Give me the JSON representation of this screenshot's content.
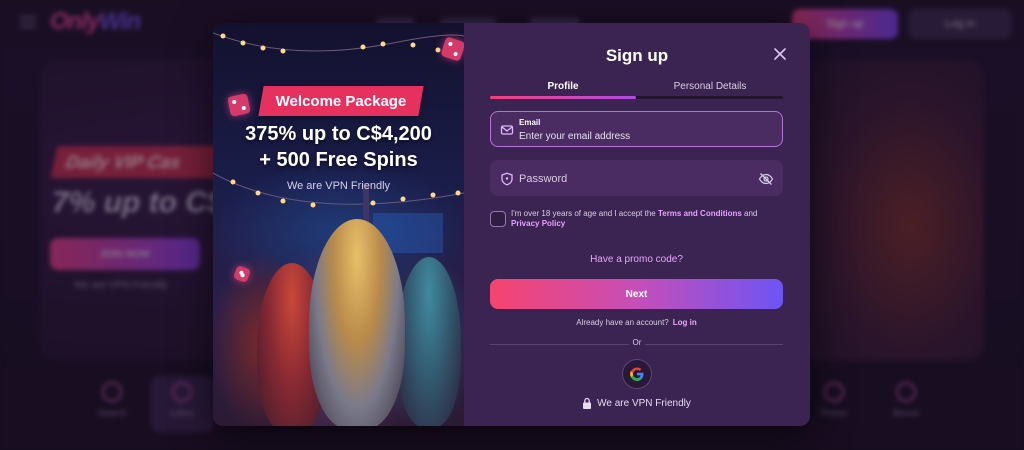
{
  "background": {
    "logo_part1": "Only",
    "logo_part2": "Win",
    "header_signup": "Sign up",
    "header_login": "Log in",
    "hero_ribbon": "Daily VIP Cas",
    "hero_big": "7% up to C$",
    "hero_join": "JOIN NOW",
    "hero_vpn": "We are VPN Friendly",
    "bottom_nav": [
      "Search",
      "Lobby",
      "Promo",
      "Bonus"
    ]
  },
  "promo": {
    "ribbon": "Welcome Package",
    "bonus_line1": "375% up to C$4,200",
    "bonus_line2": "+ 500 Free Spins",
    "vpn_text": "We are VPN Friendly"
  },
  "form": {
    "title": "Sign up",
    "tabs": [
      {
        "label": "Profile",
        "active": true
      },
      {
        "label": "Personal Details",
        "active": false
      }
    ],
    "email_label": "Email",
    "email_placeholder": "Enter your email address",
    "password_placeholder": "Password",
    "terms_prefix": "I'm over 18 years of age and I accept the ",
    "terms_link": "Terms and Conditions",
    "terms_and": " and",
    "privacy_link": "Privacy Policy",
    "promo_code": "Have a promo code?",
    "next_button": "Next",
    "already_text": "Already have an account?",
    "login_link": "Log in",
    "or_text": "Or",
    "vpn_text": "We are VPN Friendly"
  },
  "icons": {
    "close": "close-icon",
    "email": "envelope-icon",
    "password": "shield-icon",
    "toggle": "eye-off-icon",
    "google": "google-icon",
    "vpn": "lock-icon"
  },
  "colors": {
    "modal_bg": "#3b2352",
    "accent_pink": "#f6446f",
    "accent_purple": "#6c55f4",
    "link": "#e8a6ff"
  }
}
